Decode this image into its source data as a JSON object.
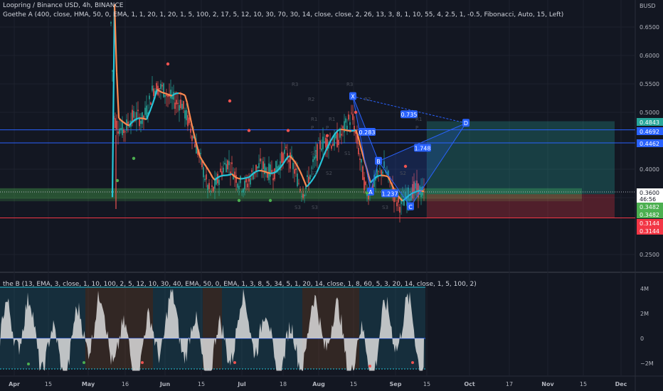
{
  "header": {
    "symbol_line": "Loopring / Binance USD, 4h, BINANCE",
    "indicator_line": "Goethe A (400, close, HMA, 50, 0, EMA, 1, 1, 20, 1, 20, 1, 5, 100, 2, 17, 5, 12, 10, 30, 70, 30, 14, close, close, 2, 26, 13, 3, 8, 1, 10, 55, 4, 2.5, 1, -0.5, Fibonacci, Auto, 15, Left)",
    "oscillator_line": "the B (13, EMA, 3, close, 1, 10, 100, 2, 5, 12, 10, 30, 40, EMA, 50, 0, EMA, 1, 3, 8, 5, 34, 5, 1, 20, 14, close, 1, 8, 60, 5, 3, 20, 14, close, 1, 5, 100, 2)"
  },
  "chart_data": {
    "type": "candlestick",
    "currency_label": "BUSD",
    "y_axis_ticks": [
      "0.6500",
      "0.6000",
      "0.5500",
      "0.5000",
      "0.4000",
      "0.3500",
      "0.2500"
    ],
    "x_axis_ticks": [
      "Apr",
      "15",
      "May",
      "16",
      "Jun",
      "15",
      "Jul",
      "18",
      "Aug",
      "15",
      "Sep",
      "15",
      "Oct",
      "17",
      "Nov",
      "15",
      "Dec"
    ],
    "price_labels": [
      {
        "text": "0.4843",
        "value": 0.4843,
        "color": "#26a69a"
      },
      {
        "text": "0.4692",
        "value": 0.4692,
        "color": "#2962ff"
      },
      {
        "text": "0.4462",
        "value": 0.4462,
        "color": "#2962ff"
      },
      {
        "text": "0.3600",
        "value": 0.36,
        "color": "#ffffff",
        "sub": "46:56"
      },
      {
        "text": "0.3482",
        "value": 0.3482,
        "color": "#4caf50"
      },
      {
        "text": "0.3482",
        "value": 0.3482,
        "color": "#4caf50"
      },
      {
        "text": "0.3144",
        "value": 0.3144,
        "color": "#f23645"
      },
      {
        "text": "0.3144",
        "value": 0.3144,
        "color": "#f23645"
      }
    ],
    "horizontal_lines": [
      {
        "value": 0.4692,
        "color": "#2962ff"
      },
      {
        "value": 0.4462,
        "color": "#2962ff"
      },
      {
        "value": 0.3144,
        "color": "#f23645"
      }
    ],
    "harmonic_pattern": {
      "points": [
        {
          "label": "X",
          "value": 0.528
        },
        {
          "label": "A",
          "value": 0.36
        },
        {
          "label": "B",
          "value": 0.414
        },
        {
          "label": "C",
          "value": 0.334
        },
        {
          "label": "D",
          "value": 0.481
        }
      ],
      "ratios": [
        "0.735",
        "0.283",
        "1.748",
        "1.237"
      ]
    },
    "pivot_labels": [
      "R3",
      "R2",
      "R1",
      "P",
      "S1",
      "S2",
      "S3"
    ],
    "oscillator": {
      "y_axis_ticks": [
        "4M",
        "2M",
        "0",
        "−2M"
      ]
    }
  }
}
